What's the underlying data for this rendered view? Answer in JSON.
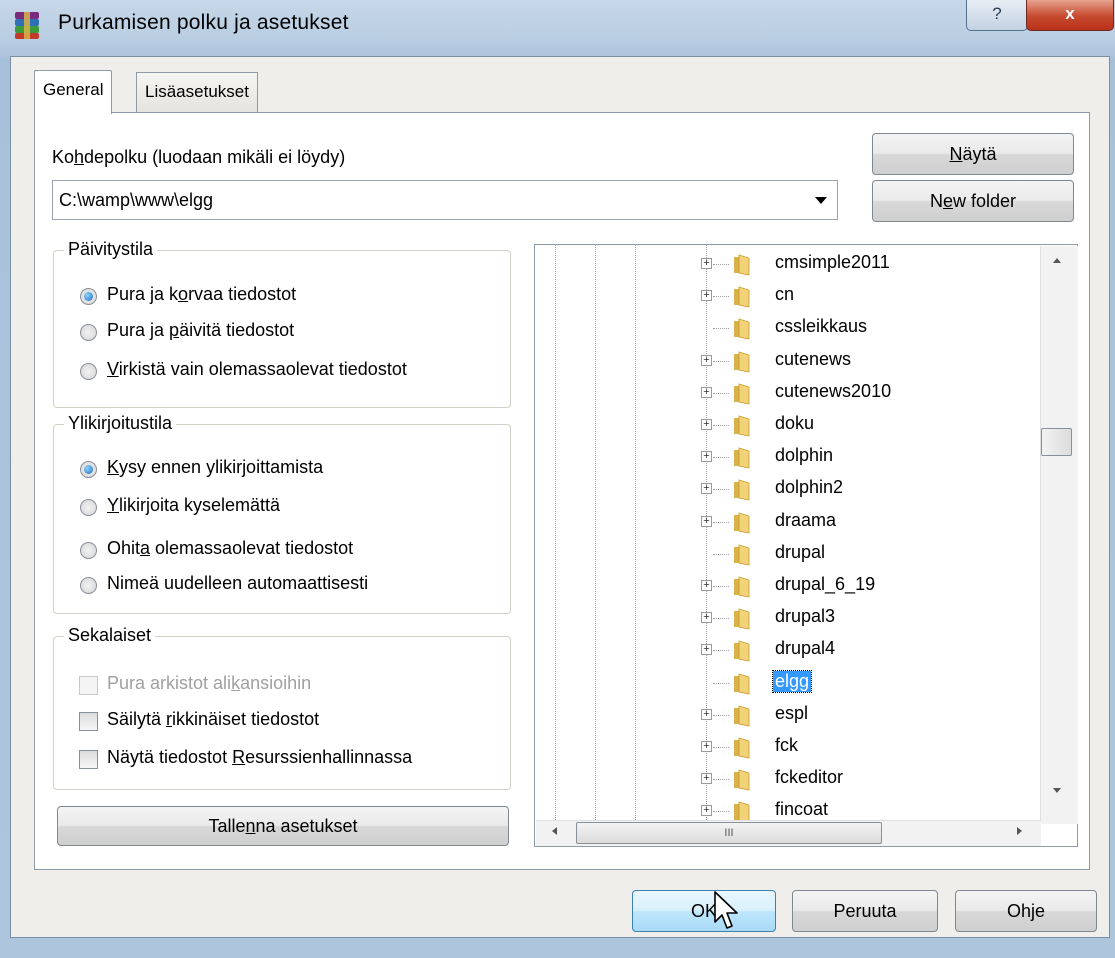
{
  "window": {
    "title": "Purkamisen polku ja asetukset",
    "help_label": "?",
    "close_label": "x"
  },
  "tabs": [
    {
      "label": "General",
      "active": true
    },
    {
      "label": "Lisäasetukset",
      "active": false
    }
  ],
  "destination": {
    "label_pre": "Ko",
    "label_u": "h",
    "label_post": "depolku (luodaan mikäli ei löydy)",
    "value": "C:\\wamp\\www\\elgg"
  },
  "buttons": {
    "show_u": "N",
    "show_rest": "äytä",
    "new_folder_pre": "N",
    "new_folder_u": "e",
    "new_folder_post": "w folder",
    "save_pre": "Talle",
    "save_u": "n",
    "save_post": "na asetukset",
    "ok": "OK",
    "cancel": "Peruuta",
    "help": "Ohje"
  },
  "update_mode": {
    "legend": "Päivitystila",
    "options": [
      {
        "pre": "Pura ja k",
        "u": "o",
        "post": "rvaa tiedostot",
        "selected": true
      },
      {
        "pre": "Pura ja ",
        "u": "p",
        "post": "äivitä tiedostot",
        "selected": false
      },
      {
        "pre": "",
        "u": "V",
        "post": "irkistä vain olemassaolevat tiedostot",
        "selected": false
      }
    ]
  },
  "overwrite_mode": {
    "legend": "Ylikirjoitustila",
    "options": [
      {
        "pre": "",
        "u": "K",
        "post": "ysy ennen ylikirjoittamista",
        "selected": true
      },
      {
        "pre": "",
        "u": "Y",
        "post": "likirjoita kyselemättä",
        "selected": false
      },
      {
        "pre": "Ohit",
        "u": "a",
        "post": " olemassaolevat tiedostot",
        "selected": false
      },
      {
        "pre": "Nimeä uudelleen automaattisesti",
        "u": "",
        "post": "",
        "selected": false
      }
    ]
  },
  "misc": {
    "legend": "Sekalaiset",
    "options": [
      {
        "pre": "Pura arkistot ali",
        "u": "k",
        "post": "ansioihin",
        "checked": false,
        "disabled": true
      },
      {
        "pre": "Säilytä ",
        "u": "r",
        "post": "ikkinäiset tiedostot",
        "checked": false,
        "disabled": false
      },
      {
        "pre": "Näytä tiedostot ",
        "u": "R",
        "post": "esurssienhallinnassa",
        "checked": false,
        "disabled": false
      }
    ]
  },
  "folder_tree": {
    "items": [
      {
        "name": "cmsimple2011",
        "expandable": true,
        "selected": false
      },
      {
        "name": "cn",
        "expandable": true,
        "selected": false
      },
      {
        "name": "cssleikkaus",
        "expandable": false,
        "selected": false
      },
      {
        "name": "cutenews",
        "expandable": true,
        "selected": false
      },
      {
        "name": "cutenews2010",
        "expandable": true,
        "selected": false
      },
      {
        "name": "doku",
        "expandable": true,
        "selected": false
      },
      {
        "name": "dolphin",
        "expandable": true,
        "selected": false
      },
      {
        "name": "dolphin2",
        "expandable": true,
        "selected": false
      },
      {
        "name": "draama",
        "expandable": true,
        "selected": false
      },
      {
        "name": "drupal",
        "expandable": false,
        "selected": false
      },
      {
        "name": "drupal_6_19",
        "expandable": true,
        "selected": false
      },
      {
        "name": "drupal3",
        "expandable": true,
        "selected": false
      },
      {
        "name": "drupal4",
        "expandable": true,
        "selected": false
      },
      {
        "name": "elgg",
        "expandable": false,
        "selected": true
      },
      {
        "name": "espl",
        "expandable": true,
        "selected": false
      },
      {
        "name": "fck",
        "expandable": true,
        "selected": false
      },
      {
        "name": "fckeditor",
        "expandable": true,
        "selected": false
      },
      {
        "name": "fincoat",
        "expandable": true,
        "selected": false
      }
    ],
    "hscroll_grip": "III"
  },
  "colors": {
    "selection": "#3399ff",
    "close_button": "#c6492d",
    "radio_dot": "#1a6fb8"
  }
}
